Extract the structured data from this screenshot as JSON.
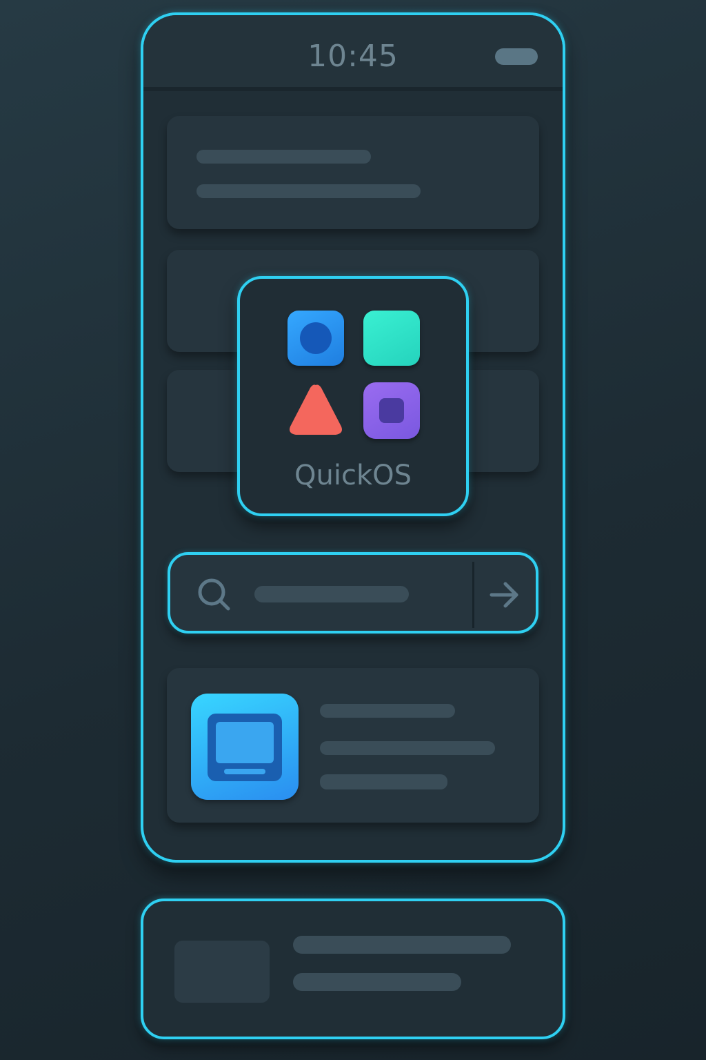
{
  "status_bar": {
    "time": "10:45"
  },
  "widget": {
    "title": "QuickOS"
  },
  "icons": {
    "status_pill": "battery-pill-icon",
    "widget_apps": [
      "blue-circle-app-icon",
      "teal-square-app-icon",
      "red-triangle-app-icon",
      "purple-square-app-icon"
    ],
    "search": "search-icon",
    "go": "arrow-right-icon",
    "featured_app": "monitor-app-icon"
  },
  "colors": {
    "accent": "#2fd0f2",
    "background": "#1d2b33",
    "app_blue": "#2a8cf0",
    "app_teal": "#2fe0c8",
    "app_red": "#f2675e",
    "app_purple": "#8a63e6"
  }
}
